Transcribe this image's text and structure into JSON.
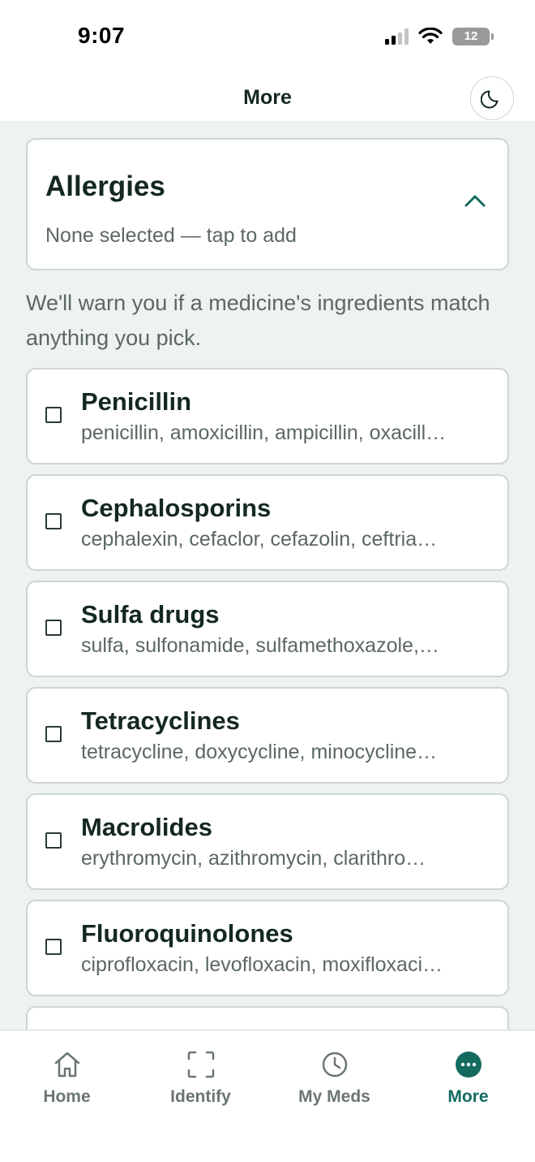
{
  "status_bar": {
    "time": "9:07",
    "battery": "12"
  },
  "header": {
    "title": "More",
    "theme_toggle_icon": "moon-icon"
  },
  "allergies": {
    "title": "Allergies",
    "subtitle": "None selected — tap to add",
    "expanded": true,
    "description": "We'll warn you if a medicine's ingredients match anything you pick."
  },
  "drug_groups": [
    {
      "name": "Penicillin",
      "ingredients": "penicillin, amoxicillin, ampicillin, oxacill…",
      "checked": false
    },
    {
      "name": "Cephalosporins",
      "ingredients": "cephalexin, cefaclor, cefazolin, ceftria…",
      "checked": false
    },
    {
      "name": "Sulfa drugs",
      "ingredients": "sulfa, sulfonamide, sulfamethoxazole,…",
      "checked": false
    },
    {
      "name": "Tetracyclines",
      "ingredients": "tetracycline, doxycycline, minocycline…",
      "checked": false
    },
    {
      "name": "Macrolides",
      "ingredients": "erythromycin, azithromycin, clarithro…",
      "checked": false
    },
    {
      "name": "Fluoroquinolones",
      "ingredients": "ciprofloxacin, levofloxacin, moxifloxaci…",
      "checked": false
    }
  ],
  "tabs": [
    {
      "label": "Home",
      "icon": "home-icon",
      "active": false
    },
    {
      "label": "Identify",
      "icon": "scan-icon",
      "active": false
    },
    {
      "label": "My Meds",
      "icon": "clock-icon",
      "active": false
    },
    {
      "label": "More",
      "icon": "more-icon",
      "active": true
    }
  ],
  "colors": {
    "accent": "#136b60",
    "background": "#eef2f0",
    "card_border": "#cdd6d1",
    "text_primary": "#14281f",
    "text_secondary": "#5b6862"
  }
}
